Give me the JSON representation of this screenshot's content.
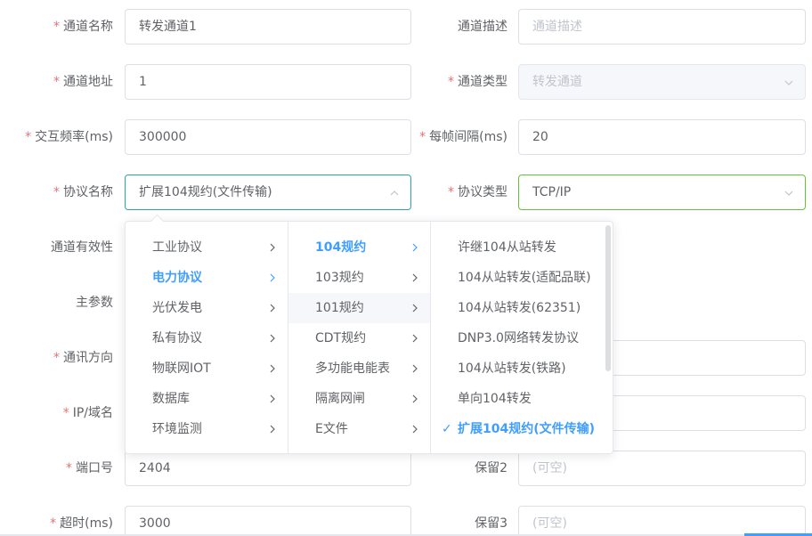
{
  "form": {
    "channel_name_label": "通道名称",
    "channel_name_value": "转发通道1",
    "channel_desc_label": "通道描述",
    "channel_desc_placeholder": "通道描述",
    "channel_addr_label": "通道地址",
    "channel_addr_value": "1",
    "channel_type_label": "通道类型",
    "channel_type_value": "转发通道",
    "interact_freq_label": "交互频率(ms)",
    "interact_freq_value": "300000",
    "frame_interval_label": "每帧间隔(ms)",
    "frame_interval_value": "20",
    "protocol_name_label": "协议名称",
    "protocol_name_value": "扩展104规约(文件传输)",
    "protocol_type_label": "协议类型",
    "protocol_type_value": "TCP/IP",
    "channel_valid_label": "通道有效性",
    "main_param_label": "主参数",
    "comm_direction_label": "通讯方向",
    "ip_label": "IP/域名",
    "port_label": "端口号",
    "port_value": "2404",
    "reserve2_label": "保留2",
    "reserve2_placeholder": "(可空)",
    "timeout_label": "超时(ms)",
    "timeout_value": "3000",
    "reserve3_label": "保留3",
    "reserve3_placeholder": "(可空)",
    "required_mark": "*"
  },
  "cascader": {
    "level1": [
      {
        "label": "工业协议",
        "active": false
      },
      {
        "label": "电力协议",
        "active": true
      },
      {
        "label": "光伏发电",
        "active": false
      },
      {
        "label": "私有协议",
        "active": false
      },
      {
        "label": "物联网IOT",
        "active": false
      },
      {
        "label": "数据库",
        "active": false
      },
      {
        "label": "环境监测",
        "active": false
      }
    ],
    "level2": [
      {
        "label": "104规约",
        "active": true
      },
      {
        "label": "103规约",
        "active": false
      },
      {
        "label": "101规约",
        "active": false,
        "hover": true
      },
      {
        "label": "CDT规约",
        "active": false
      },
      {
        "label": "多功能电能表",
        "active": false
      },
      {
        "label": "隔离网闸",
        "active": false
      },
      {
        "label": "E文件",
        "active": false
      }
    ],
    "level3": [
      {
        "label": "许继104从站转发",
        "active": false
      },
      {
        "label": "104从站转发(适配品联)",
        "active": false
      },
      {
        "label": "104从站转发(62351)",
        "active": false
      },
      {
        "label": "DNP3.0网络转发协议",
        "active": false
      },
      {
        "label": "104从站转发(铁路)",
        "active": false
      },
      {
        "label": "单向104转发",
        "active": false
      },
      {
        "label": "扩展104规约(文件传输)",
        "active": true
      }
    ],
    "check_mark": "✓"
  },
  "colors": {
    "accent": "#409eff",
    "required": "#f56c6c",
    "focus_green": "#67c23a"
  }
}
